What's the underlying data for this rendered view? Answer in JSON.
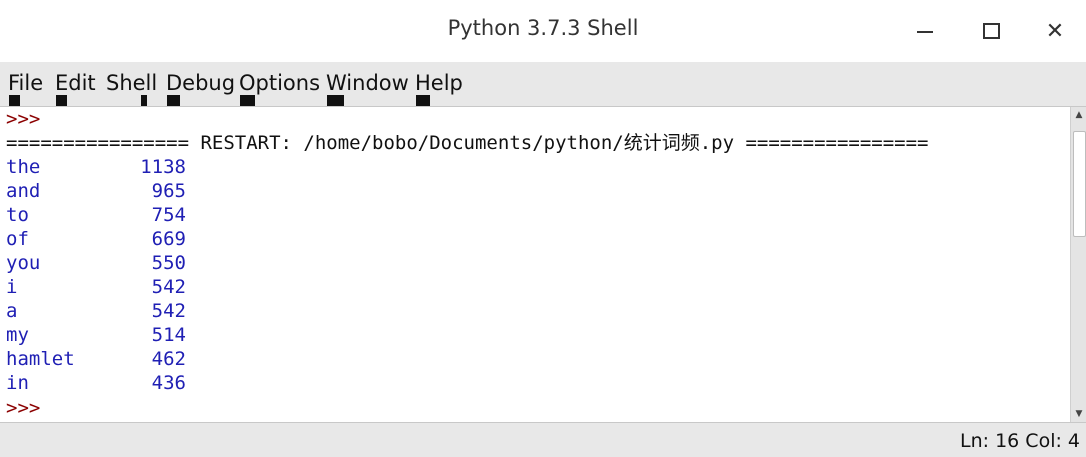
{
  "window": {
    "title": "Python 3.7.3 Shell",
    "minimize_icon": "minimize-icon",
    "maximize_icon": "maximize-icon",
    "close_icon": "close-icon",
    "close_glyph": "✕"
  },
  "menu": {
    "items": [
      "File",
      "Edit",
      "Shell",
      "Debug",
      "Options",
      "Window",
      "Help"
    ]
  },
  "shell": {
    "prompt": ">>>",
    "restart_line": "================ RESTART: /home/bobo/Documents/python/统计词频.py ================",
    "rows": [
      {
        "word": "the",
        "count": "1138"
      },
      {
        "word": "and",
        "count": "965"
      },
      {
        "word": "to",
        "count": "754"
      },
      {
        "word": "of",
        "count": "669"
      },
      {
        "word": "you",
        "count": "550"
      },
      {
        "word": "i",
        "count": "542"
      },
      {
        "word": "a",
        "count": "542"
      },
      {
        "word": "my",
        "count": "514"
      },
      {
        "word": "hamlet",
        "count": "462"
      },
      {
        "word": "in",
        "count": "436"
      }
    ],
    "final_prompt": ">>>"
  },
  "status": {
    "position": "Ln: 16  Col: 4"
  },
  "colors": {
    "prompt": "#8b0000",
    "output": "#1f1fb4",
    "text": "#111111"
  }
}
